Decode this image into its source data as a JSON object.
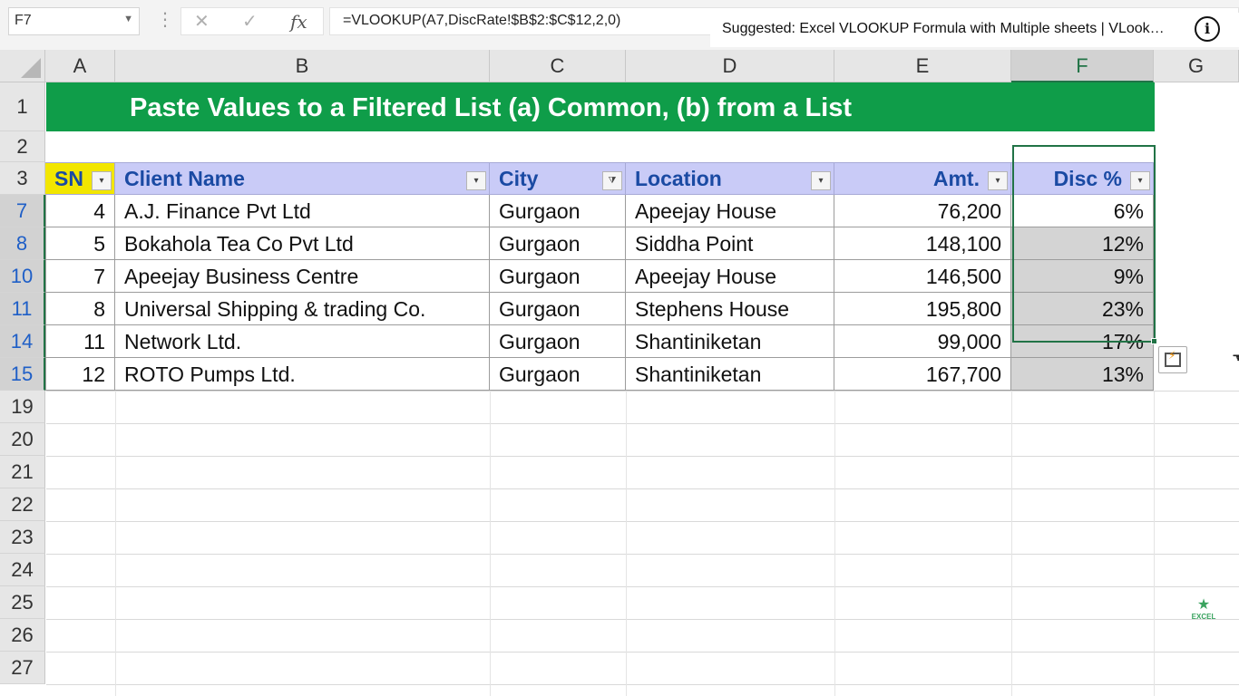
{
  "formula_bar": {
    "name_box": "F7",
    "formula": "=VLOOKUP(A7,DiscRate!$B$2:$C$12,2,0)",
    "cancel_icon": "x-icon",
    "enter_icon": "check-icon",
    "function_icon": "fx-icon",
    "fx_glyph": "fx"
  },
  "suggestion": {
    "text": "Suggested: Excel VLOOKUP Formula with Multiple sheets | VLook…",
    "info_glyph": "i"
  },
  "columns": [
    "A",
    "B",
    "C",
    "D",
    "E",
    "F",
    "G"
  ],
  "selected_column": "F",
  "rows": {
    "title_row": "1",
    "blank_row": "2",
    "header_row": "3",
    "data_rows": [
      "7",
      "8",
      "10",
      "11",
      "14",
      "15"
    ],
    "empty_rows": [
      "19",
      "20",
      "21",
      "22",
      "23",
      "24",
      "25",
      "26",
      "27"
    ]
  },
  "title": "Paste Values to a Filtered List (a) Common, (b) from a List",
  "table": {
    "headers": [
      {
        "label": "SN",
        "filter": "dropdown"
      },
      {
        "label": "Client Name",
        "filter": "dropdown"
      },
      {
        "label": "City",
        "filter": "filtered"
      },
      {
        "label": "Location",
        "filter": "dropdown"
      },
      {
        "label": "Amt.",
        "filter": "dropdown"
      },
      {
        "label": "Disc %",
        "filter": "dropdown"
      }
    ],
    "rows": [
      {
        "sn": "4",
        "client": "A.J. Finance Pvt Ltd",
        "city": "Gurgaon",
        "location": "Apeejay House",
        "amt": "76,200",
        "disc": "6%"
      },
      {
        "sn": "5",
        "client": "Bokahola Tea Co Pvt Ltd",
        "city": "Gurgaon",
        "location": "Siddha Point",
        "amt": "148,100",
        "disc": "12%"
      },
      {
        "sn": "7",
        "client": "Apeejay Business Centre",
        "city": "Gurgaon",
        "location": "Apeejay House",
        "amt": "146,500",
        "disc": "9%"
      },
      {
        "sn": "8",
        "client": "Universal Shipping & trading Co.",
        "city": "Gurgaon",
        "location": "Stephens House",
        "amt": "195,800",
        "disc": "23%"
      },
      {
        "sn": "11",
        "client": "Network Ltd.",
        "city": "Gurgaon",
        "location": "Shantiniketan",
        "amt": "99,000",
        "disc": "17%"
      },
      {
        "sn": "12",
        "client": "ROTO Pumps Ltd.",
        "city": "Gurgaon",
        "location": "Shantiniketan",
        "amt": "167,700",
        "disc": "13%"
      }
    ]
  },
  "icons": {
    "quick_analysis": "quick-analysis-icon",
    "watermark": "excel-logo-icon"
  },
  "watermark_text": "EXCEL",
  "colors": {
    "title_band": "#0f9d49",
    "header_fill": "#c9cbf7",
    "sn_header_fill": "#f2e600",
    "header_text": "#1a4aa3",
    "selection": "#217346",
    "filtered_row_number": "#1f5fc7"
  }
}
